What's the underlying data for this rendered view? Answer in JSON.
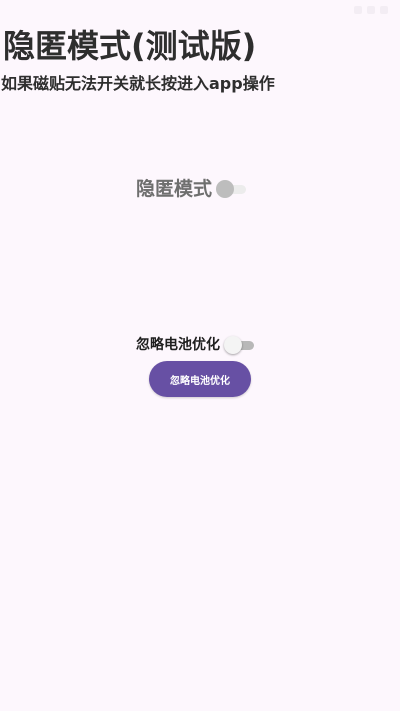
{
  "header": {
    "title": "隐匿模式(测试版)",
    "subtitle": "如果磁贴无法开关就长按进入app操作"
  },
  "hidden_mode": {
    "label": "隐匿模式",
    "enabled": false,
    "disabled": true
  },
  "battery_optimization": {
    "label": "忽略电池优化",
    "enabled": false,
    "button_label": "忽略电池优化"
  },
  "colors": {
    "background": "#fdf7fd",
    "primary": "#6750a4",
    "title_text": "#2e2e2e",
    "disabled_text": "#6f6f6f"
  },
  "status_bar": {
    "icons": [
      "signal-icon",
      "wifi-icon",
      "battery-icon"
    ]
  }
}
